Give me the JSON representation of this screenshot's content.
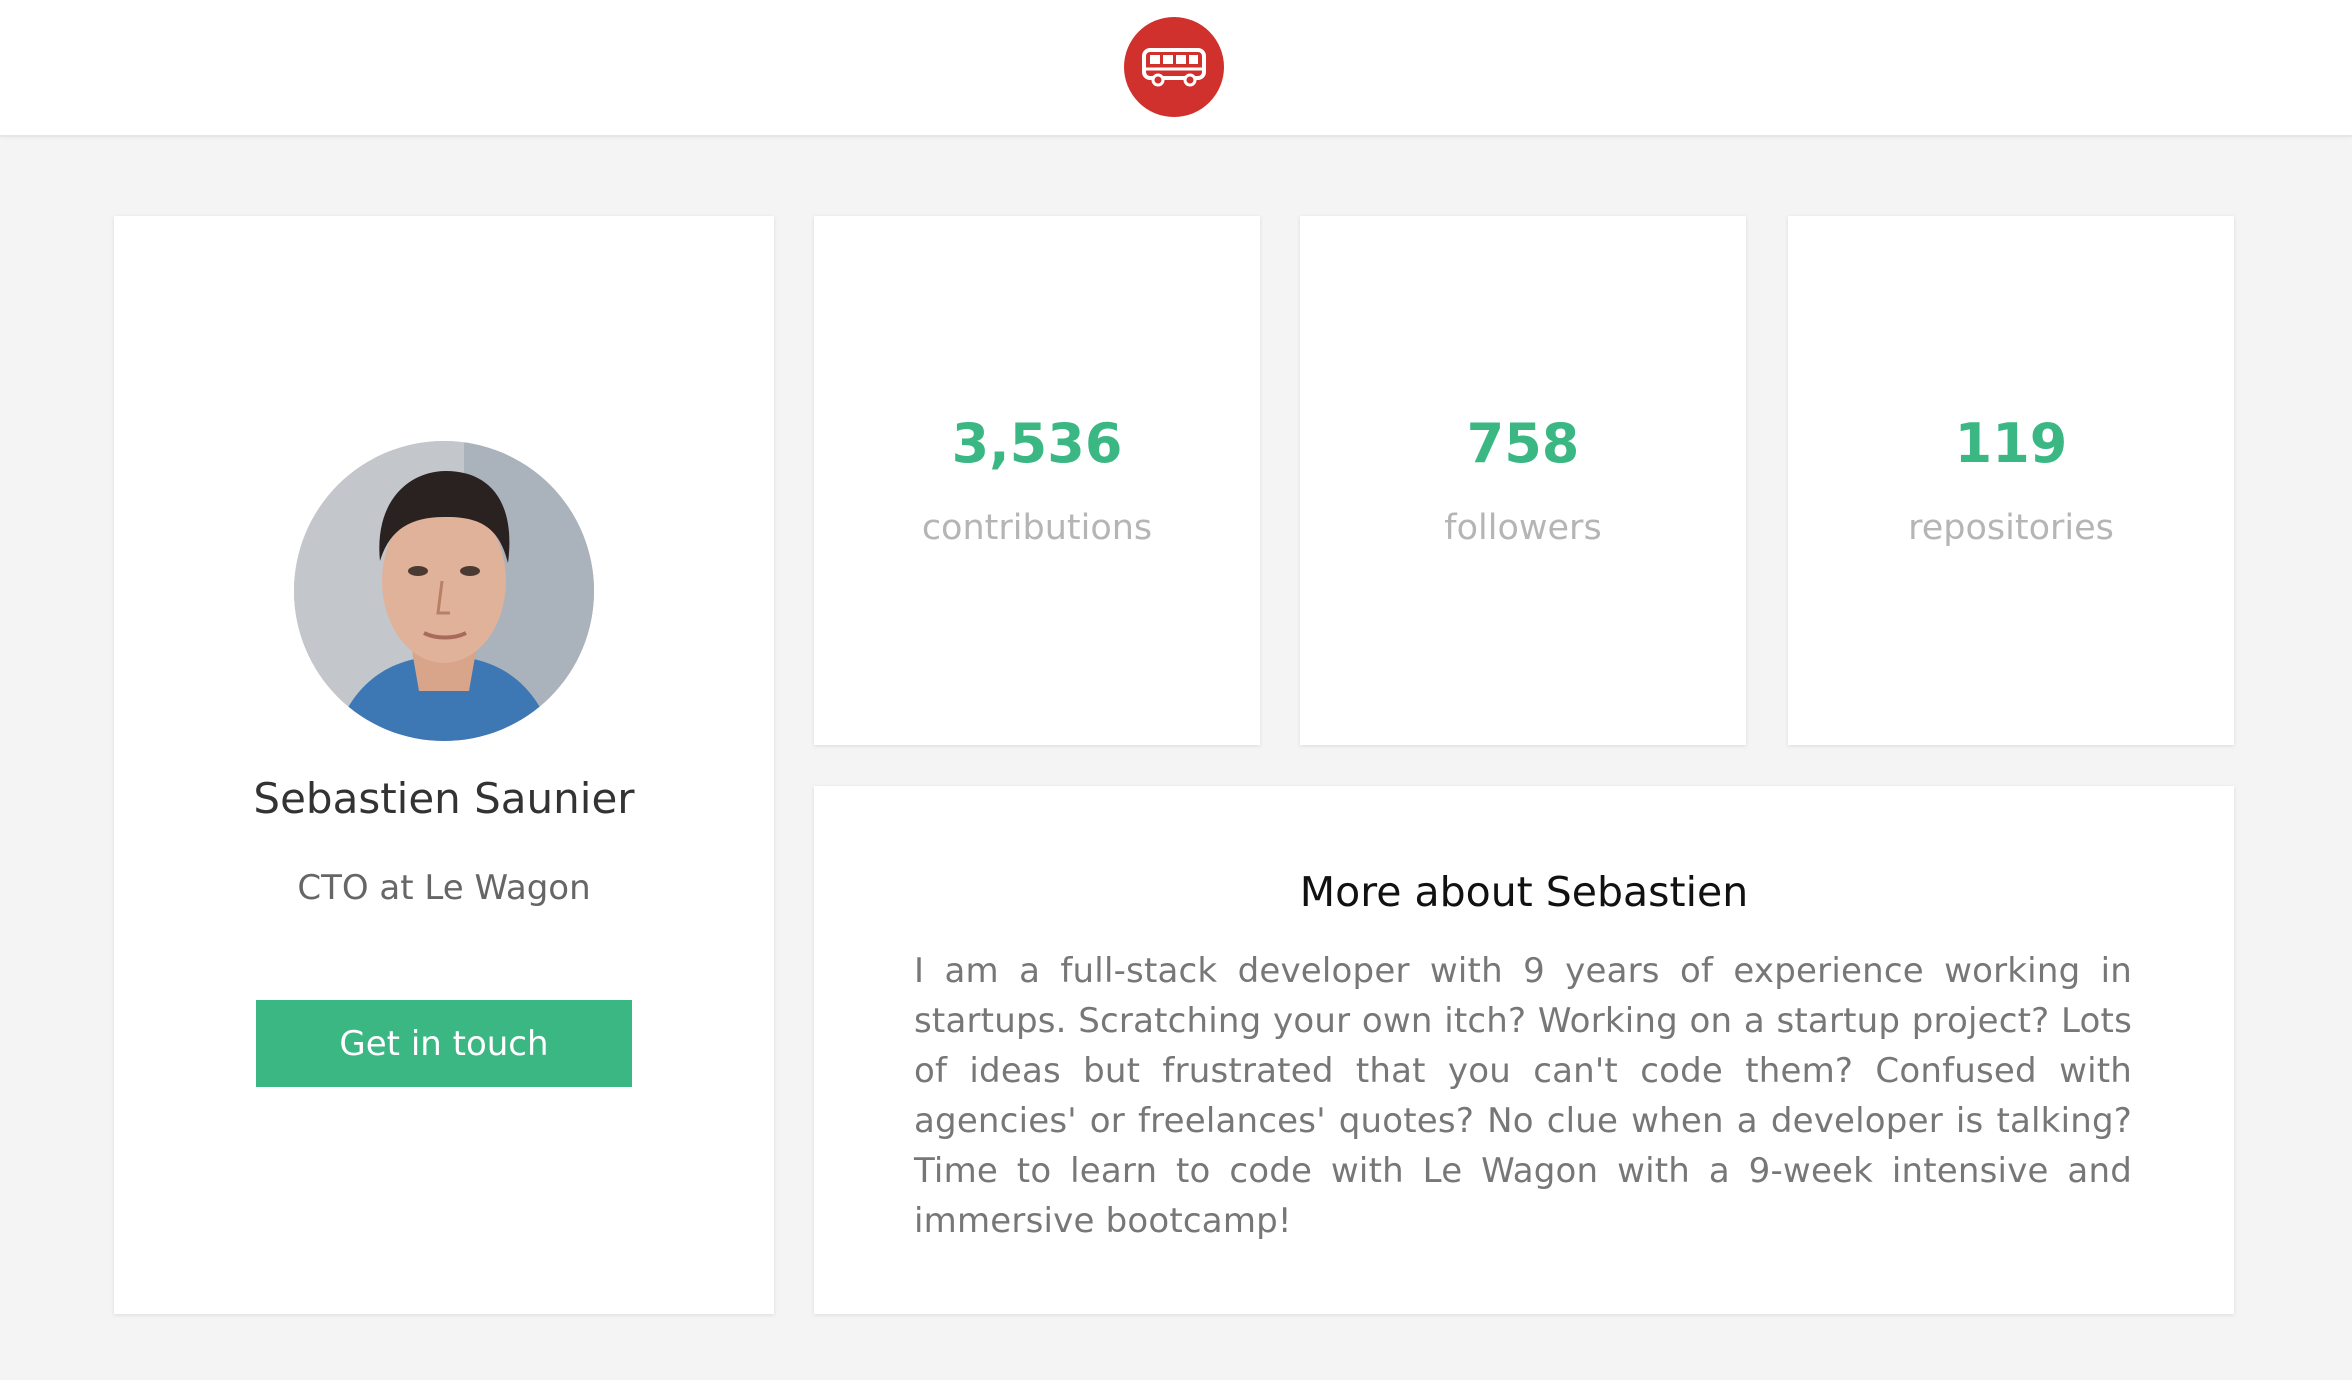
{
  "navbar": {
    "logo_icon": "bus-icon",
    "logo_color": "#d0312d"
  },
  "profile": {
    "name": "Sebastien Saunier",
    "title": "CTO at Le Wagon",
    "cta_label": "Get in touch",
    "accent_color": "#3bb784"
  },
  "stats": [
    {
      "value": "3,536",
      "label": "contributions"
    },
    {
      "value": "758",
      "label": "followers"
    },
    {
      "value": "119",
      "label": "repositories"
    }
  ],
  "about": {
    "heading": "More about Sebastien",
    "body": "I am a full-stack developer with 9 years of experience working in startups. Scratching your own itch? Working on a startup project? Lots of ideas but frustrated that you can't code them? Confused with agencies' or freelances' quotes? No clue when a developer is talking? Time to learn to code with Le Wagon with a 9-week intensive and immersive bootcamp!"
  }
}
